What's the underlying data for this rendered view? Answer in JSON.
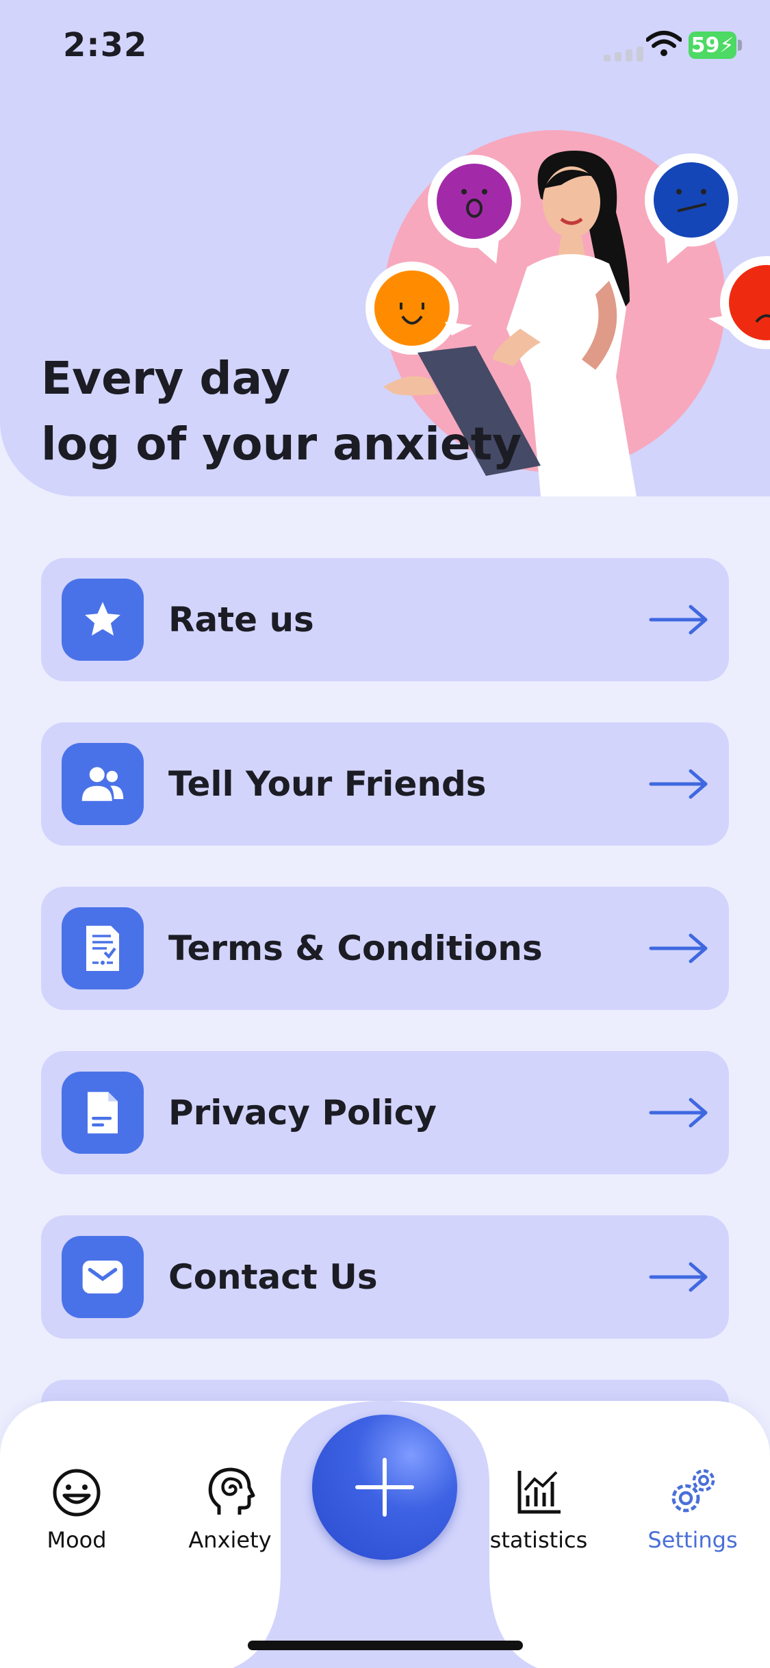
{
  "status_bar": {
    "time": "2:32",
    "battery": "59"
  },
  "hero": {
    "title_line1": "Every day",
    "title_line2": "log of your anxiety"
  },
  "menu": [
    {
      "label": "Rate us",
      "icon": "star-icon"
    },
    {
      "label": "Tell Your Friends",
      "icon": "friends-icon"
    },
    {
      "label": "Terms & Conditions",
      "icon": "document-check-icon"
    },
    {
      "label": "Privacy Policy",
      "icon": "file-icon"
    },
    {
      "label": "Contact Us",
      "icon": "mail-icon"
    }
  ],
  "tabs": [
    {
      "label": "Mood",
      "icon": "smile-icon"
    },
    {
      "label": "Anxiety",
      "icon": "head-spiral-icon"
    },
    {
      "label": "statistics",
      "icon": "bar-chart-icon"
    },
    {
      "label": "Settings",
      "icon": "gears-icon",
      "active": true
    }
  ],
  "fab": {
    "icon": "plus-icon"
  },
  "colors": {
    "accent": "#4a72e8",
    "card": "#d2d4fc",
    "background": "#eceefe"
  }
}
